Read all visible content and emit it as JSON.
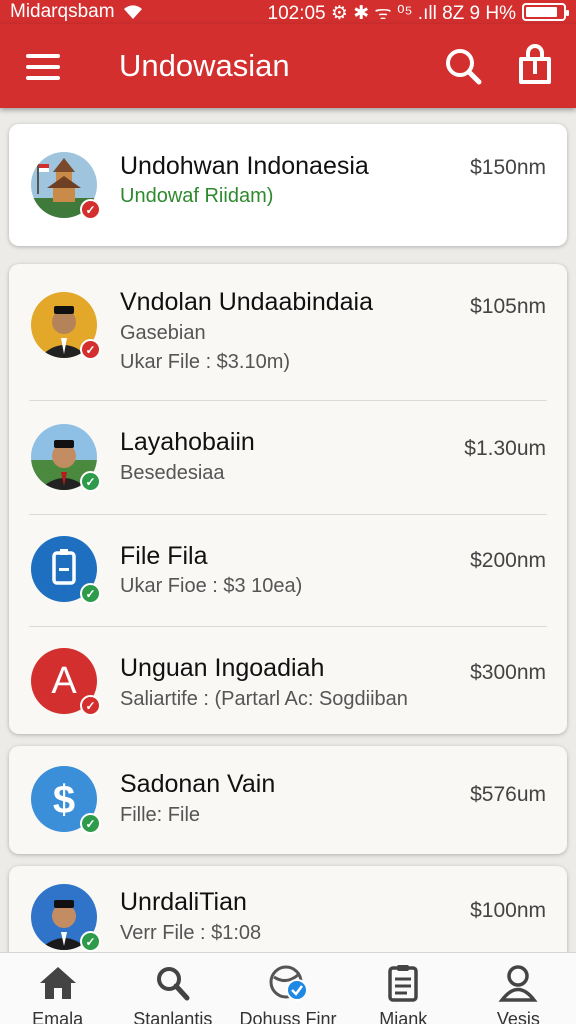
{
  "status_bar": {
    "carrier": "Midarqsbam",
    "right_text": "102:05 ⚙ ✱ ᯤ ⁰⁵ .ıll 8Z 9 H%",
    "battery_level": 0.85
  },
  "app_bar": {
    "title": "Undowasian",
    "icons": [
      "menu-icon",
      "search-icon",
      "bag-icon"
    ]
  },
  "cards": [
    {
      "items": [
        {
          "name": "Undohwan Indonaesia",
          "lines": [
            "Undowaf Riidam)"
          ],
          "price": "$150nm",
          "avatar": "temple",
          "badge": "red",
          "highlight": true
        }
      ]
    },
    {
      "items": [
        {
          "name": "Vndolan Undaabindaia",
          "lines": [
            "Gasebian",
            "Ukar File : $3.10m)"
          ],
          "price": "$105nm",
          "avatar": "person-yellow",
          "badge": "red"
        },
        {
          "name": "Layahobaiin",
          "lines": [
            "Besedesiaa"
          ],
          "price": "$1.30um",
          "avatar": "person-landscape",
          "badge": "green"
        },
        {
          "name": "File Fila",
          "lines": [
            "Ukar Fioe : $3 10ea)"
          ],
          "price": "$200nm",
          "avatar": "file-blue",
          "badge": "green"
        },
        {
          "name": "Unguan Ingoadiah",
          "lines": [
            "Saliartife : (Partarl Ac: Ѕogdiiban"
          ],
          "price": "$300nm",
          "avatar": "letter-a",
          "avatar_text": "A",
          "badge": "red"
        }
      ]
    },
    {
      "items": [
        {
          "name": "Sadonan Vain",
          "lines": [
            "Fille: File"
          ],
          "price": "$576um",
          "avatar": "dollar",
          "avatar_text": "$",
          "badge": "green"
        }
      ]
    },
    {
      "items": [
        {
          "name": "UnrdaliTian",
          "lines": [
            "Verr File : $1:08"
          ],
          "price": "$100nm",
          "avatar": "person-blue",
          "badge": "green"
        }
      ]
    }
  ],
  "bottom_nav": [
    {
      "label": "Emala",
      "icon": "home-icon"
    },
    {
      "label": "Stanlantis",
      "icon": "search-key-icon"
    },
    {
      "label": "Dohuss Finr",
      "icon": "globe-check-icon"
    },
    {
      "label": "Miank",
      "icon": "clipboard-icon"
    },
    {
      "label": "Vesis",
      "icon": "profile-icon"
    }
  ],
  "colors": {
    "primary": "#d32f2f",
    "badge_green": "#2e9b4b",
    "icon_blue": "#1e6fc0",
    "background": "#ecebe8"
  }
}
